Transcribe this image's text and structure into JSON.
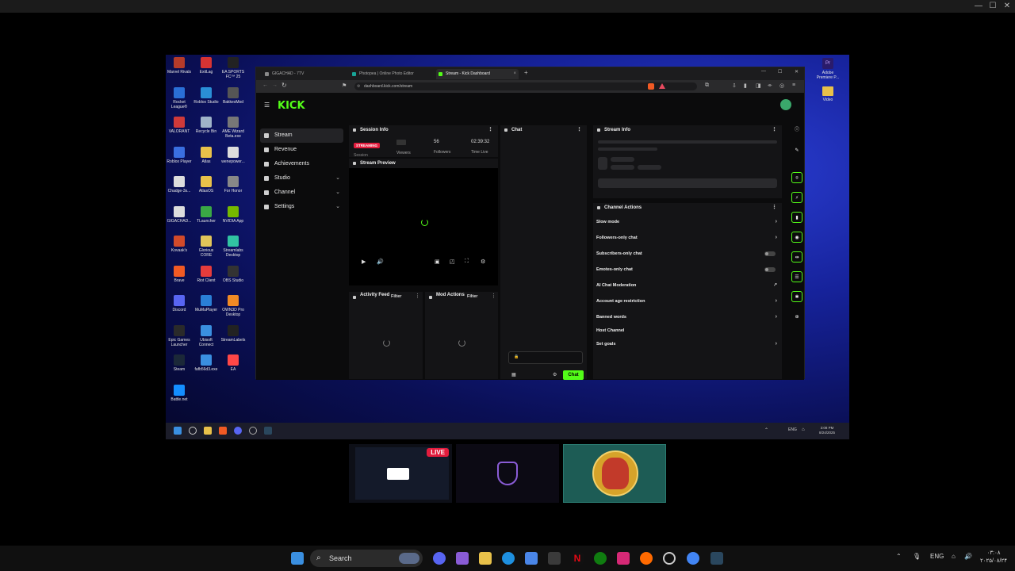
{
  "host": {
    "controls": [
      "—",
      "☐",
      "✕"
    ]
  },
  "desktop_left_icons": [
    {
      "label": "Marvel Rivals",
      "color": "#b53b2a"
    },
    {
      "label": "ExitLag",
      "color": "#d63333"
    },
    {
      "label": "EA SPORTS FC™ 25",
      "color": "#222222"
    },
    {
      "label": "Rocket League®",
      "color": "#2a6fd6"
    },
    {
      "label": "Roblox Studio",
      "color": "#2a8fd6"
    },
    {
      "label": "BakkesMod",
      "color": "#555555"
    },
    {
      "label": "VALORANT",
      "color": "#cf3a3a"
    },
    {
      "label": "Recycle Bin",
      "color": "#9fb3c8"
    },
    {
      "label": "AME Wizard Beta.exe",
      "color": "#777777"
    },
    {
      "label": "Roblox Player",
      "color": "#3a6fe0"
    },
    {
      "label": "Atlas",
      "color": "#e8c14a"
    },
    {
      "label": "wenepower...",
      "color": "#dddddd"
    },
    {
      "label": "Chadge-3s...",
      "color": "#dddddd"
    },
    {
      "label": "AtlasOS",
      "color": "#e8c14a"
    },
    {
      "label": "For Honor",
      "color": "#888888"
    },
    {
      "label": "GIGACHAD...",
      "color": "#dddddd"
    },
    {
      "label": "TLauncher",
      "color": "#3aa845"
    },
    {
      "label": "NVIDIA App",
      "color": "#76b900"
    },
    {
      "label": "Kovaak's",
      "color": "#d24a2a"
    },
    {
      "label": "Glorious CORE",
      "color": "#e2c55a"
    },
    {
      "label": "Streamlabs Desktop",
      "color": "#31c3a2"
    },
    {
      "label": "Brave",
      "color": "#f15a24"
    },
    {
      "label": "Riot Client",
      "color": "#e63c3c"
    },
    {
      "label": "OBS Studio",
      "color": "#333333"
    },
    {
      "label": "Discord",
      "color": "#5865f2"
    },
    {
      "label": "MuMuPlayer",
      "color": "#2a7fd6"
    },
    {
      "label": "OWN3D Pro Desktop",
      "color": "#f08a24"
    },
    {
      "label": "Epic Games Launcher",
      "color": "#2a2a2a"
    },
    {
      "label": "Ubisoft Connect",
      "color": "#3a8fe0"
    },
    {
      "label": "StreamLabels",
      "color": "#222222"
    },
    {
      "label": "Steam",
      "color": "#1b2838"
    },
    {
      "label": "fafb56d3.exe",
      "color": "#3a8fe0"
    },
    {
      "label": "EA",
      "color": "#ff4747"
    },
    {
      "label": "Battle.net",
      "color": "#148eff"
    }
  ],
  "desktop_right_icons": [
    {
      "label": "Adobe Premiere P...",
      "color": "#2a1b6b"
    },
    {
      "label": "Video",
      "color": "#e8c14a"
    }
  ],
  "browser": {
    "tabs": [
      {
        "label": "GIGACHAD - 7TV",
        "color": "#8a8a8a"
      },
      {
        "label": "Photopea | Online Photo Editor",
        "color": "#18a497"
      },
      {
        "label": "Stream - Kick Dashboard",
        "color": "#53fc18"
      }
    ],
    "new_tab": "+",
    "window_controls": [
      "—",
      "☐",
      "✕"
    ],
    "url": "dashboard.kick.com/stream"
  },
  "kick": {
    "logo": "KICK",
    "nav": [
      {
        "label": "Stream",
        "chevron": ""
      },
      {
        "label": "Revenue",
        "chevron": ""
      },
      {
        "label": "Achievements",
        "chevron": ""
      },
      {
        "label": "Studio",
        "chevron": "⌄"
      },
      {
        "label": "Channel",
        "chevron": "⌄"
      },
      {
        "label": "Settings",
        "chevron": "⌄"
      }
    ],
    "session": {
      "title": "Session Info",
      "badge": "STREAMING",
      "session_label": "Session",
      "viewers_label": "Viewers",
      "followers_value": "56",
      "followers_label": "Followers",
      "time_value": "02:39:32",
      "time_label": "Time Live"
    },
    "preview_title": "Stream Preview",
    "activity_title": "Activity Feed",
    "activity_filter": "Filter",
    "mod_title": "Mod Actions",
    "mod_filter": "Filter",
    "chat_title": "Chat",
    "chat_button": "Chat",
    "stream_info_title": "Stream Info",
    "channel_actions_title": "Channel Actions",
    "actions": [
      {
        "label": "Slow mode",
        "control": "arrow"
      },
      {
        "label": "Followers-only chat",
        "control": "arrow"
      },
      {
        "label": "Subscribers-only chat",
        "control": "toggle"
      },
      {
        "label": "Emotes-only chat",
        "control": "toggle"
      },
      {
        "label": "AI Chat Moderation",
        "control": "external"
      },
      {
        "label": "Account age restriction",
        "control": "arrow"
      },
      {
        "label": "Banned words",
        "control": "arrow"
      },
      {
        "label": "Host Channel",
        "control": "none"
      },
      {
        "label": "Set goals",
        "control": "arrow"
      }
    ]
  },
  "remote_taskbar": {
    "lang": "ENG",
    "time": "3:08 PM",
    "date": "8/24/2025"
  },
  "participants": {
    "live_badge": "LIVE"
  },
  "taskbar": {
    "search_label": "Search",
    "lang": "ENG",
    "time": "۰۳:۰۸",
    "date": "۲۰۲۵/۰۸/۲۴"
  }
}
